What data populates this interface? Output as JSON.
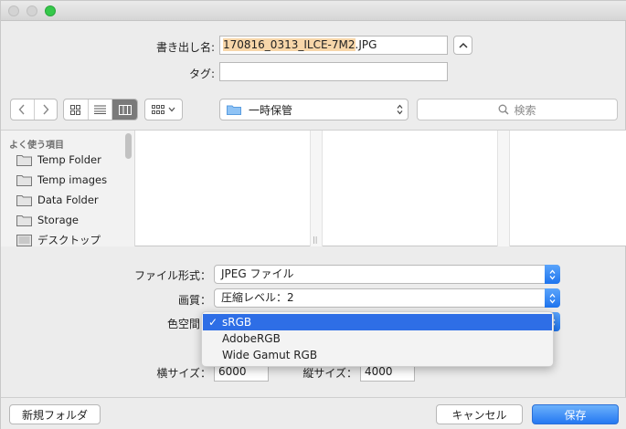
{
  "window": {
    "title_controls": [
      "close",
      "minimize",
      "zoom"
    ]
  },
  "export": {
    "name_label": "書き出し名:",
    "name_selected": "170816_0313_ILCE-7M2",
    "name_ext": ".JPG",
    "tags_label": "タグ:",
    "tags_value": ""
  },
  "toolbar": {
    "location": "一時保管",
    "search_placeholder": "検索"
  },
  "sidebar": {
    "heading": "よく使う項目",
    "items": [
      {
        "label": "Temp Folder",
        "icon": "folder-icon"
      },
      {
        "label": "Temp images",
        "icon": "folder-icon"
      },
      {
        "label": "Data Folder",
        "icon": "folder-icon"
      },
      {
        "label": "Storage",
        "icon": "folder-icon"
      },
      {
        "label": "デスクトップ",
        "icon": "desktop-icon"
      }
    ]
  },
  "options": {
    "format_label": "ファイル形式：",
    "format_value": "JPEG ファイル",
    "quality_label": "画質：",
    "quality_value": "圧縮レベル：2",
    "colorspace_label": "色空間",
    "colorspace_options": [
      "sRGB",
      "AdobeRGB",
      "Wide Gamut RGB"
    ],
    "colorspace_selected": "sRGB",
    "width_label": "横サイズ：",
    "width_value": "6000",
    "height_label": "縦サイズ：",
    "height_value": "4000"
  },
  "buttons": {
    "new_folder": "新規フォルダ",
    "cancel": "キャンセル",
    "save": "保存"
  },
  "colors": {
    "accent": "#2e6ee6",
    "selection": "#f7d6a9",
    "zoom": "#35c84a"
  }
}
